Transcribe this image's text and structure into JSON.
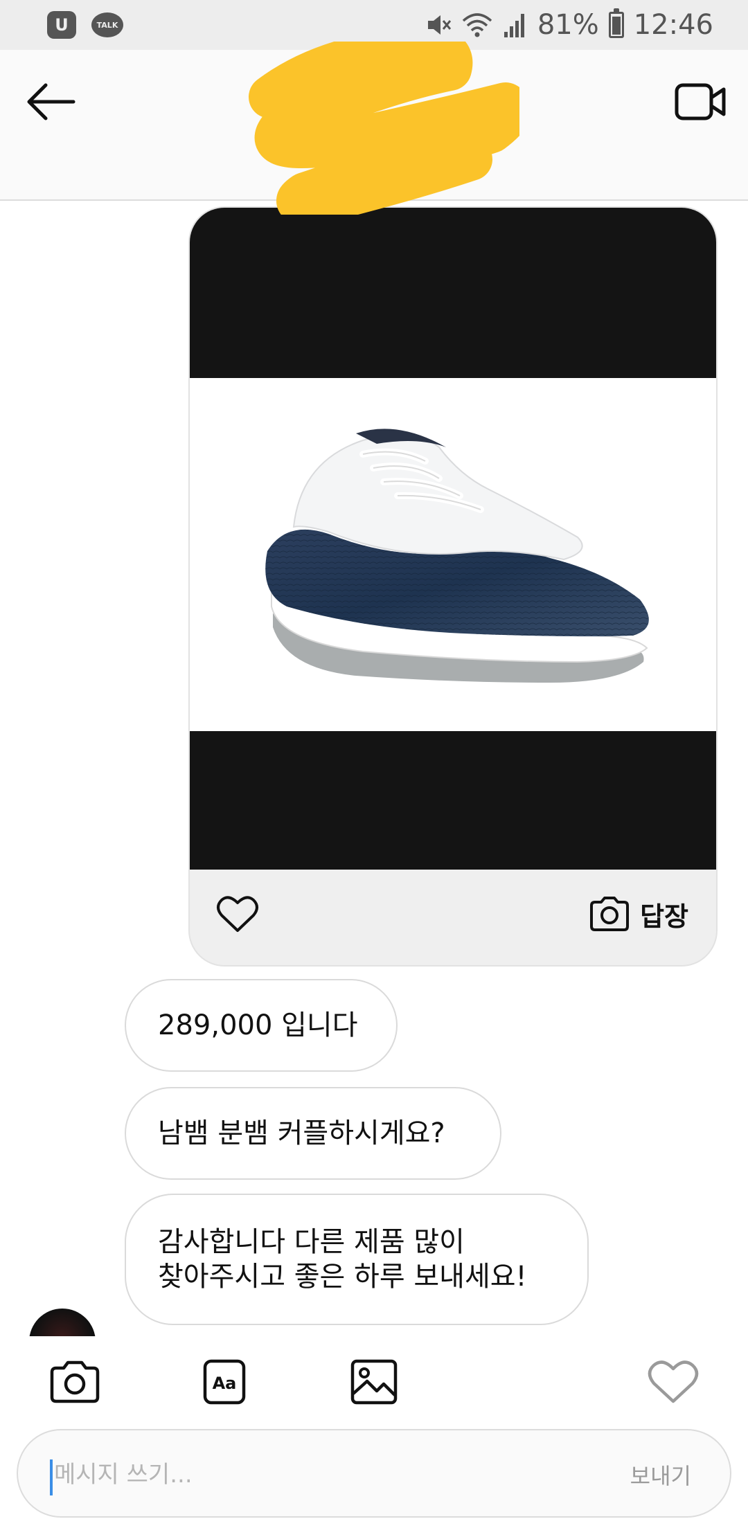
{
  "status_bar": {
    "app_badge": "U",
    "talk_badge": "TALK",
    "battery": "81%",
    "time": "12:46"
  },
  "header": {
    "back_icon": "arrow-left-icon",
    "video_icon": "video-camera-icon",
    "title": ""
  },
  "media_message": {
    "reply_label": "답장",
    "colors": {
      "letterbox": "#141414",
      "card_bg": "#efefef"
    }
  },
  "messages": [
    {
      "text": "289,000 입니다"
    },
    {
      "text": "남뱀 분뱀 커플하시게요?"
    },
    {
      "text": "감사합니다 다른 제품 많이\n찾아주시고 좋은 하루 보내세요!"
    }
  ],
  "toolbar": {
    "icons": [
      "camera-icon",
      "text-style-icon",
      "gallery-icon",
      "heart-icon"
    ]
  },
  "composer": {
    "placeholder": "메시지 쓰기...",
    "value": "",
    "send_label": "보내기"
  }
}
